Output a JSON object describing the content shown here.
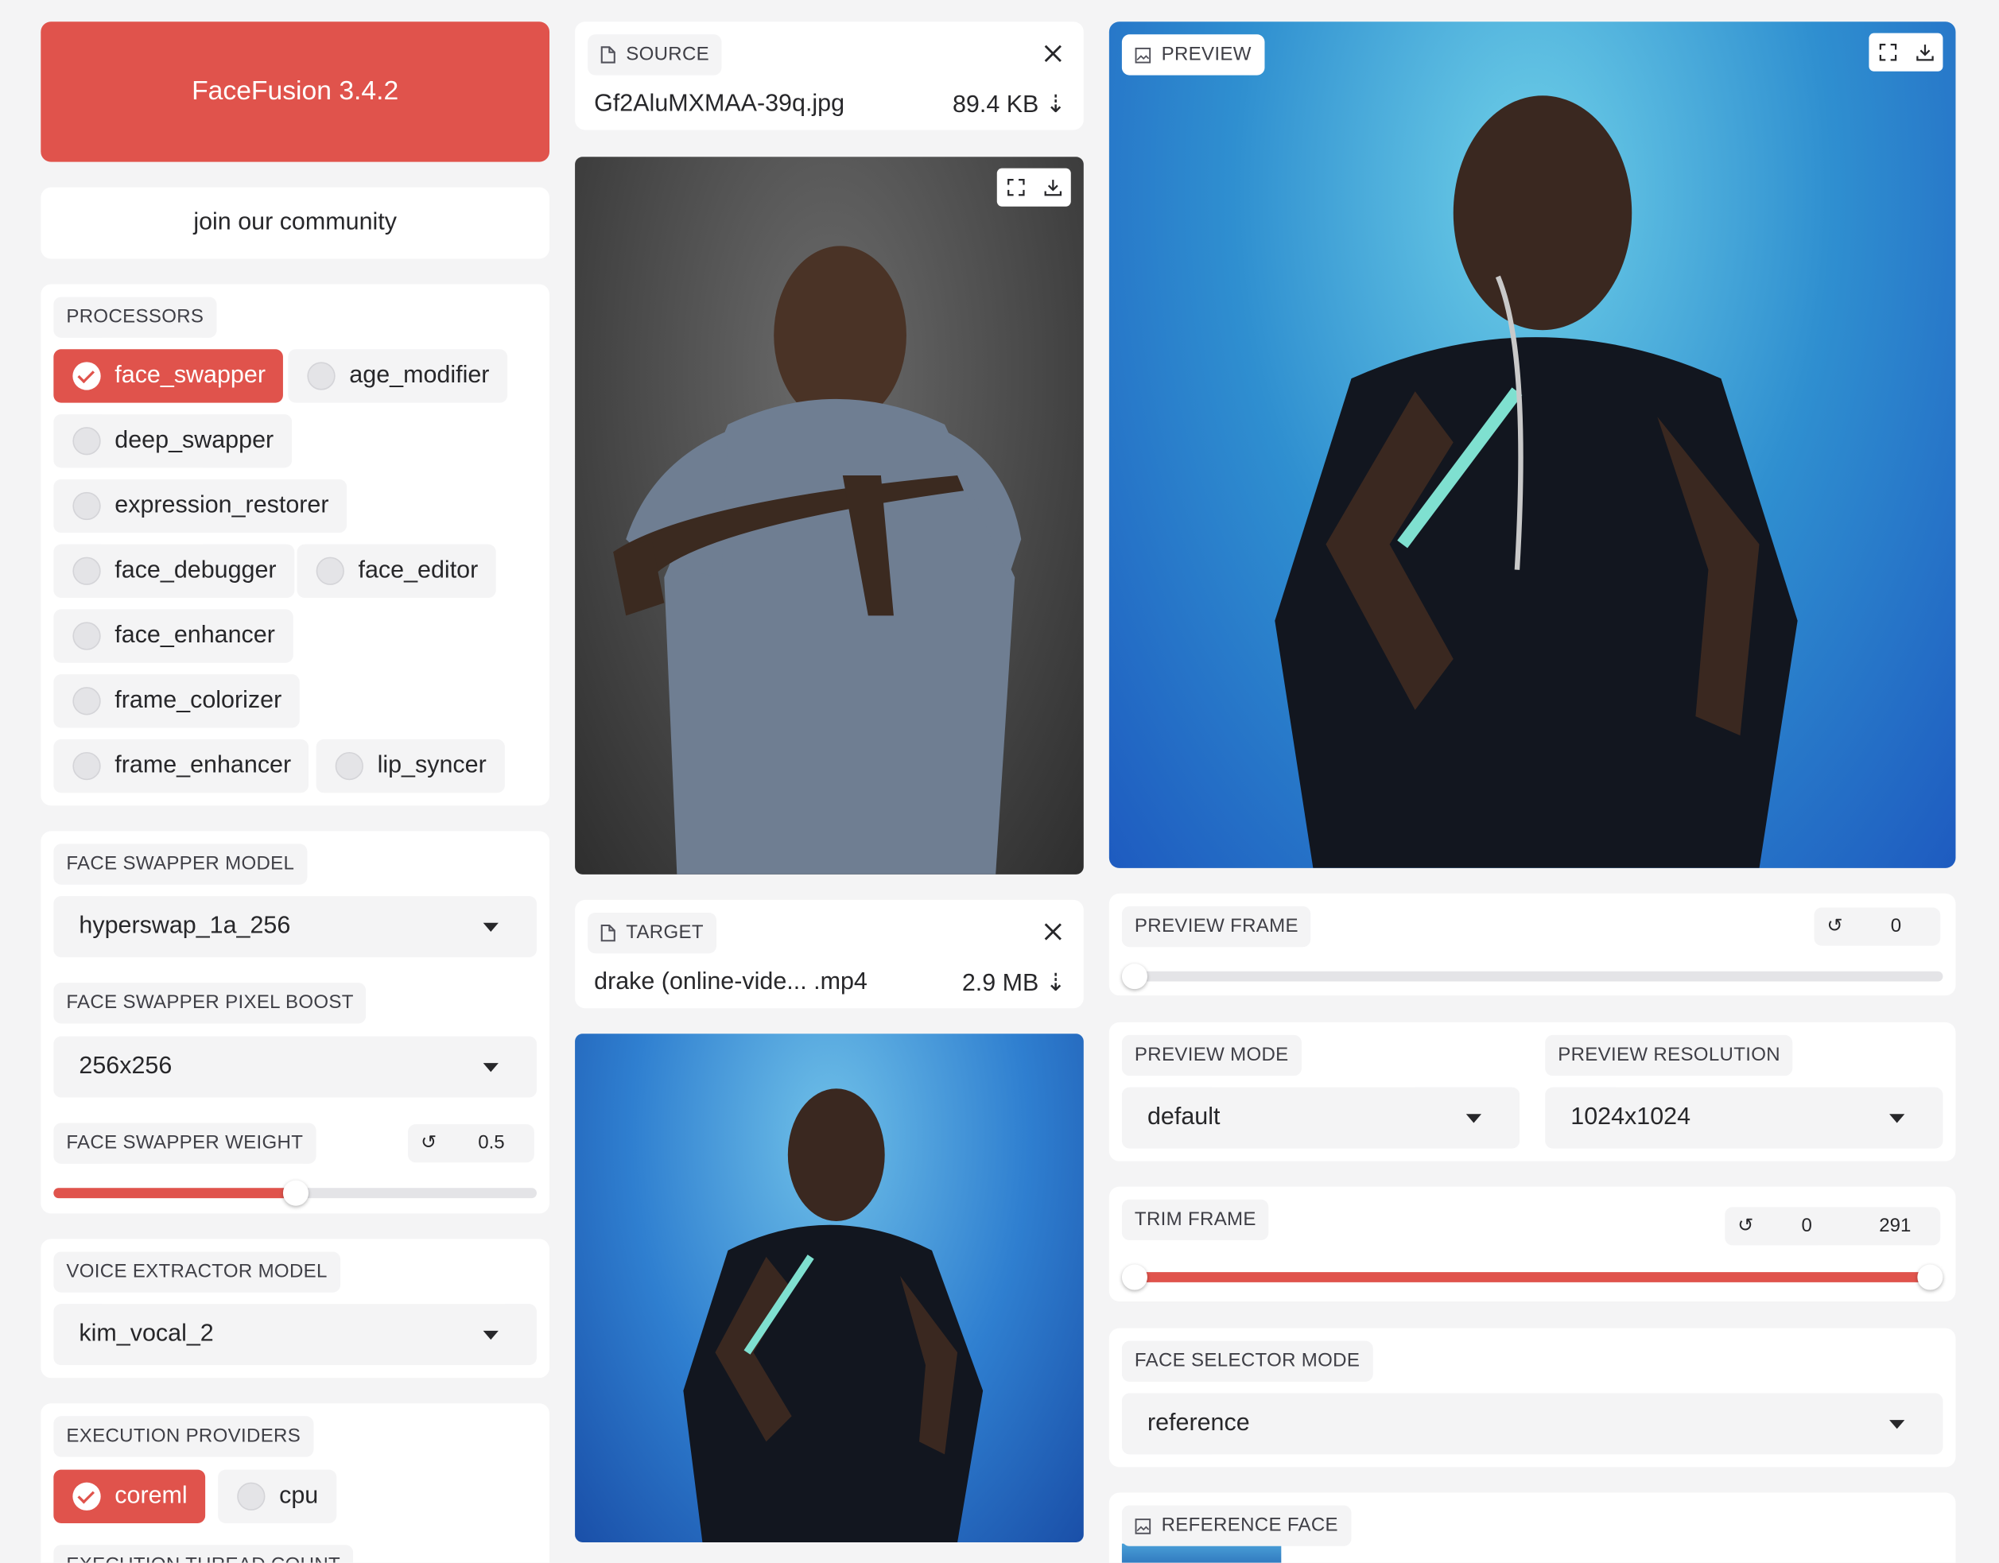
{
  "header": {
    "title": "FaceFusion 3.4.2",
    "community": "join our community"
  },
  "processors": {
    "label": "PROCESSORS",
    "items": [
      {
        "label": "face_swapper",
        "checked": true
      },
      {
        "label": "age_modifier",
        "checked": false
      },
      {
        "label": "deep_swapper",
        "checked": false
      },
      {
        "label": "expression_restorer",
        "checked": false
      },
      {
        "label": "face_debugger",
        "checked": false
      },
      {
        "label": "face_editor",
        "checked": false
      },
      {
        "label": "face_enhancer",
        "checked": false
      },
      {
        "label": "frame_colorizer",
        "checked": false
      },
      {
        "label": "frame_enhancer",
        "checked": false
      },
      {
        "label": "lip_syncer",
        "checked": false
      }
    ]
  },
  "face_swapper_model": {
    "label": "FACE SWAPPER MODEL",
    "value": "hyperswap_1a_256"
  },
  "face_swapper_pixel_boost": {
    "label": "FACE SWAPPER PIXEL BOOST",
    "value": "256x256"
  },
  "face_swapper_weight": {
    "label": "FACE SWAPPER WEIGHT",
    "reset": "↺",
    "value": "0.5",
    "fraction": 0.5
  },
  "voice_extractor_model": {
    "label": "VOICE EXTRACTOR MODEL",
    "value": "kim_vocal_2"
  },
  "execution_providers": {
    "label": "EXECUTION PROVIDERS",
    "items": [
      {
        "label": "coreml",
        "checked": true
      },
      {
        "label": "cpu",
        "checked": false
      }
    ]
  },
  "execution_thread_count": {
    "label": "EXECUTION THREAD COUNT"
  },
  "source": {
    "label": "SOURCE",
    "filename": "Gf2AluMXMAA-39q.jpg",
    "size": "89.4 KB ⇣"
  },
  "target": {
    "label": "TARGET",
    "filename": "drake (online-vide... .mp4",
    "size": "2.9 MB ⇣"
  },
  "preview": {
    "label": "PREVIEW"
  },
  "preview_frame": {
    "label": "PREVIEW FRAME",
    "reset": "↺",
    "value": "0",
    "fraction": 0
  },
  "preview_mode": {
    "label": "PREVIEW MODE",
    "value": "default"
  },
  "preview_resolution": {
    "label": "PREVIEW RESOLUTION",
    "value": "1024x1024"
  },
  "trim_frame": {
    "label": "TRIM FRAME",
    "reset": "↺",
    "start": "0",
    "end": "291",
    "start_fraction": 0,
    "end_fraction": 1
  },
  "face_selector_mode": {
    "label": "FACE SELECTOR MODE",
    "value": "reference"
  },
  "reference_face": {
    "label": "REFERENCE FACE"
  },
  "colors": {
    "accent": "#e0534c",
    "panel": "#ffffff",
    "background": "#f4f4f5"
  },
  "icons": {
    "close": "close-icon",
    "fullscreen": "fullscreen-icon",
    "download": "download-icon",
    "file": "file-icon",
    "image": "image-icon"
  }
}
